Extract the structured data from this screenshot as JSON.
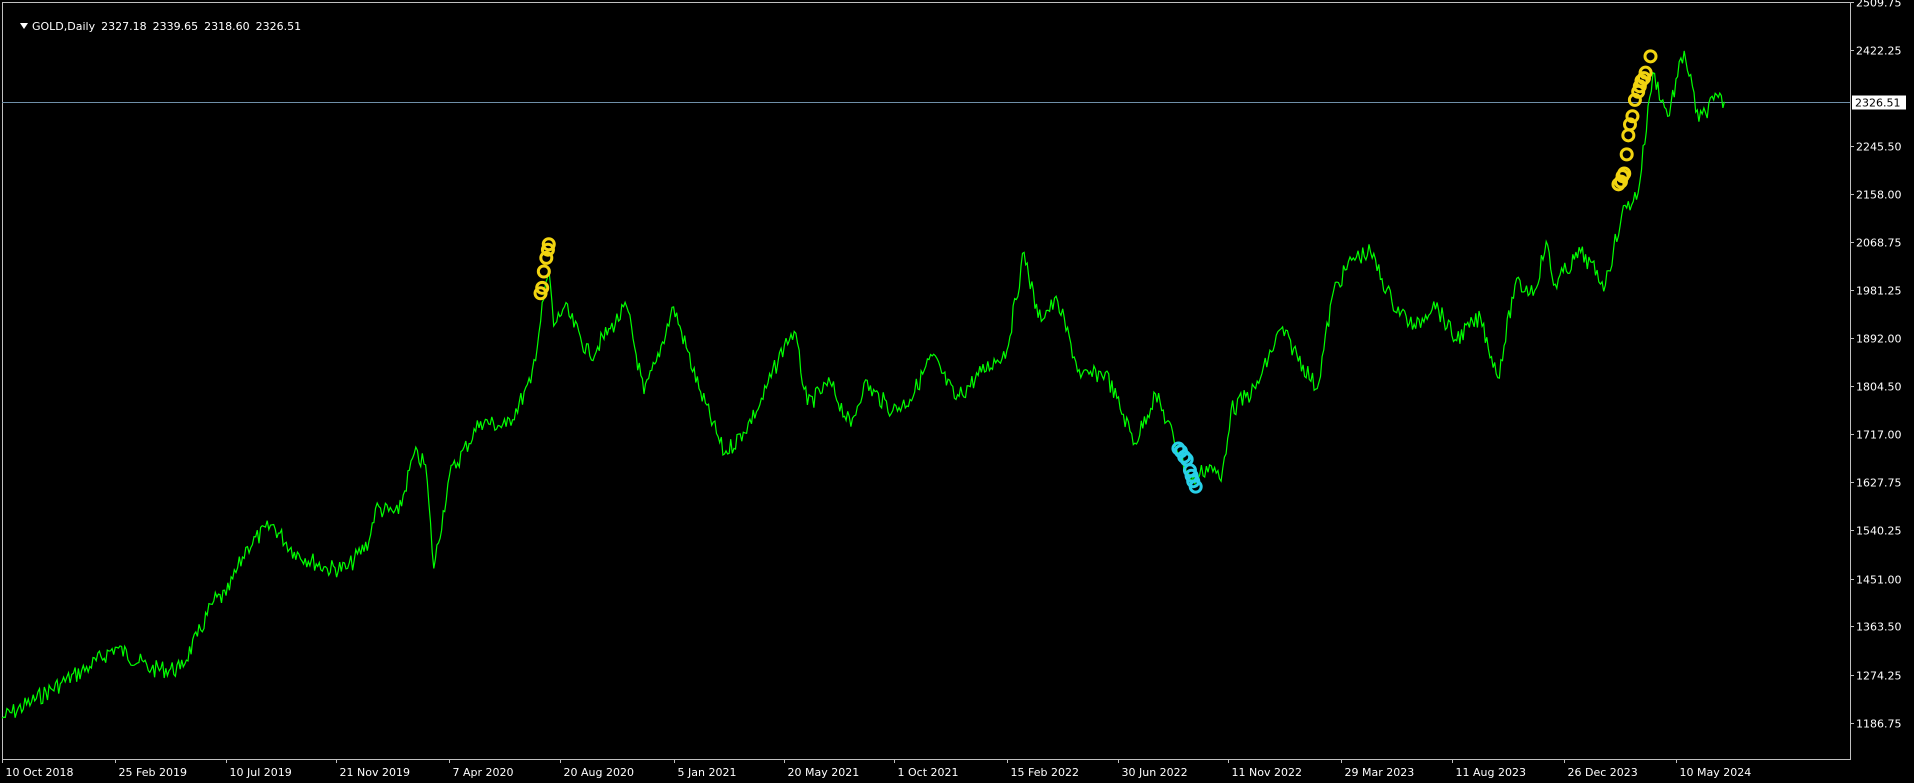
{
  "header": {
    "symbol_label": "GOLD,Daily",
    "open": "2327.18",
    "high": "2339.65",
    "low": "2318.60",
    "close": "2326.51"
  },
  "colors": {
    "background": "#000000",
    "frame": "#c0c0c0",
    "price_line": "#00ff00",
    "current_price_line": "#6f8fa8",
    "up_marker": "#f2d410",
    "down_marker": "#28d0e8",
    "text": "#ffffff"
  },
  "chart_data": {
    "type": "line",
    "title": "GOLD,Daily",
    "xlabel": "",
    "ylabel": "",
    "grid": false,
    "ylim": [
      1120.0,
      2509.75
    ],
    "xlim": [
      "2018-10-10",
      "2024-12-08"
    ],
    "y_ticks": [
      "2509.75",
      "2422.25",
      "2245.50",
      "2158.00",
      "2068.75",
      "1981.25",
      "1892.00",
      "1804.50",
      "1717.00",
      "1627.75",
      "1540.25",
      "1451.00",
      "1363.50",
      "1274.25",
      "1186.75"
    ],
    "x_ticks": [
      {
        "date": "2018-10-10",
        "label": "10 Oct 2018"
      },
      {
        "date": "2019-02-25",
        "label": "25 Feb 2019"
      },
      {
        "date": "2019-07-10",
        "label": "10 Jul 2019"
      },
      {
        "date": "2019-11-21",
        "label": "21 Nov 2019"
      },
      {
        "date": "2020-04-07",
        "label": "7 Apr 2020"
      },
      {
        "date": "2020-08-20",
        "label": "20 Aug 2020"
      },
      {
        "date": "2021-01-05",
        "label": "5 Jan 2021"
      },
      {
        "date": "2021-05-20",
        "label": "20 May 2021"
      },
      {
        "date": "2021-10-01",
        "label": "1 Oct 2021"
      },
      {
        "date": "2022-02-15",
        "label": "15 Feb 2022"
      },
      {
        "date": "2022-06-30",
        "label": "30 Jun 2022"
      },
      {
        "date": "2022-11-11",
        "label": "11 Nov 2022"
      },
      {
        "date": "2023-03-29",
        "label": "29 Mar 2023"
      },
      {
        "date": "2023-08-11",
        "label": "11 Aug 2023"
      },
      {
        "date": "2023-12-26",
        "label": "26 Dec 2023"
      },
      {
        "date": "2024-05-10",
        "label": "10 May 2024"
      }
    ],
    "current_price": 2326.51,
    "current_price_label": "2326.51",
    "series": [
      {
        "x": [
          "2018-10-10",
          "2018-11-15",
          "2018-12-20",
          "2019-01-25",
          "2019-02-25",
          "2019-04-10",
          "2019-05-15",
          "2019-06-05",
          "2019-06-25",
          "2019-07-10",
          "2019-08-05",
          "2019-09-04",
          "2019-10-01",
          "2019-11-10",
          "2019-12-05",
          "2019-12-31",
          "2020-01-08",
          "2020-02-05",
          "2020-02-24",
          "2020-03-09",
          "2020-03-19",
          "2020-04-07",
          "2020-05-15",
          "2020-06-15",
          "2020-07-15",
          "2020-08-06",
          "2020-08-12",
          "2020-08-25",
          "2020-09-25",
          "2020-10-20",
          "2020-11-09",
          "2020-11-30",
          "2020-12-15",
          "2021-01-05",
          "2021-02-05",
          "2021-03-08",
          "2021-03-31",
          "2021-04-20",
          "2021-05-20",
          "2021-06-01",
          "2021-06-17",
          "2021-07-15",
          "2021-08-09",
          "2021-08-25",
          "2021-09-29",
          "2021-10-20",
          "2021-11-16",
          "2021-12-15",
          "2022-01-15",
          "2022-02-15",
          "2022-03-08",
          "2022-03-25",
          "2022-04-18",
          "2022-05-16",
          "2022-06-15",
          "2022-07-21",
          "2022-08-15",
          "2022-09-28",
          "2022-10-20",
          "2022-11-03",
          "2022-11-15",
          "2022-12-15",
          "2023-01-15",
          "2023-02-28",
          "2023-03-20",
          "2023-04-13",
          "2023-05-04",
          "2023-05-30",
          "2023-06-28",
          "2023-07-20",
          "2023-08-15",
          "2023-09-15",
          "2023-10-06",
          "2023-10-27",
          "2023-11-20",
          "2023-12-04",
          "2023-12-13",
          "2024-01-15",
          "2024-02-14",
          "2024-03-05",
          "2024-03-25",
          "2024-04-12",
          "2024-04-30",
          "2024-05-20",
          "2024-06-07",
          "2024-06-25",
          "2024-07-08"
        ],
        "y": [
          1195,
          1225,
          1258,
          1290,
          1325,
          1285,
          1285,
          1345,
          1410,
          1420,
          1510,
          1550,
          1500,
          1470,
          1470,
          1520,
          1580,
          1570,
          1680,
          1660,
          1470,
          1640,
          1740,
          1730,
          1810,
          2020,
          1915,
          1950,
          1860,
          1910,
          1950,
          1790,
          1850,
          1950,
          1800,
          1680,
          1720,
          1770,
          1880,
          1905,
          1770,
          1810,
          1730,
          1810,
          1760,
          1780,
          1860,
          1780,
          1830,
          1870,
          2050,
          1930,
          1960,
          1820,
          1830,
          1700,
          1790,
          1630,
          1660,
          1630,
          1760,
          1800,
          1910,
          1800,
          1980,
          2040,
          2050,
          1960,
          1910,
          1960,
          1890,
          1930,
          1820,
          1990,
          1980,
          2070,
          1990,
          2050,
          1990,
          2120,
          2160,
          2380,
          2300,
          2420,
          2290,
          2330,
          2326.51
        ],
        "up_markers": [
          {
            "x": "2020-07-27",
            "y": 1975
          },
          {
            "x": "2020-07-29",
            "y": 1985
          },
          {
            "x": "2020-07-31",
            "y": 2015
          },
          {
            "x": "2020-08-03",
            "y": 2040
          },
          {
            "x": "2020-08-05",
            "y": 2055
          },
          {
            "x": "2020-08-06",
            "y": 2065
          },
          {
            "x": "2024-03-01",
            "y": 2175
          },
          {
            "x": "2024-03-04",
            "y": 2180
          },
          {
            "x": "2024-03-06",
            "y": 2190
          },
          {
            "x": "2024-03-08",
            "y": 2195
          },
          {
            "x": "2024-03-11",
            "y": 2230
          },
          {
            "x": "2024-03-13",
            "y": 2265
          },
          {
            "x": "2024-03-15",
            "y": 2285
          },
          {
            "x": "2024-03-18",
            "y": 2300
          },
          {
            "x": "2024-03-21",
            "y": 2330
          },
          {
            "x": "2024-03-25",
            "y": 2345
          },
          {
            "x": "2024-03-27",
            "y": 2355
          },
          {
            "x": "2024-03-29",
            "y": 2365
          },
          {
            "x": "2024-04-01",
            "y": 2370
          },
          {
            "x": "2024-04-03",
            "y": 2380
          },
          {
            "x": "2024-04-09",
            "y": 2410
          }
        ],
        "down_markers": [
          {
            "x": "2022-09-12",
            "y": 1690
          },
          {
            "x": "2022-09-15",
            "y": 1685
          },
          {
            "x": "2022-09-19",
            "y": 1675
          },
          {
            "x": "2022-09-22",
            "y": 1670
          },
          {
            "x": "2022-09-26",
            "y": 1650
          },
          {
            "x": "2022-09-28",
            "y": 1640
          },
          {
            "x": "2022-09-30",
            "y": 1630
          },
          {
            "x": "2022-10-03",
            "y": 1620
          }
        ]
      }
    ]
  }
}
